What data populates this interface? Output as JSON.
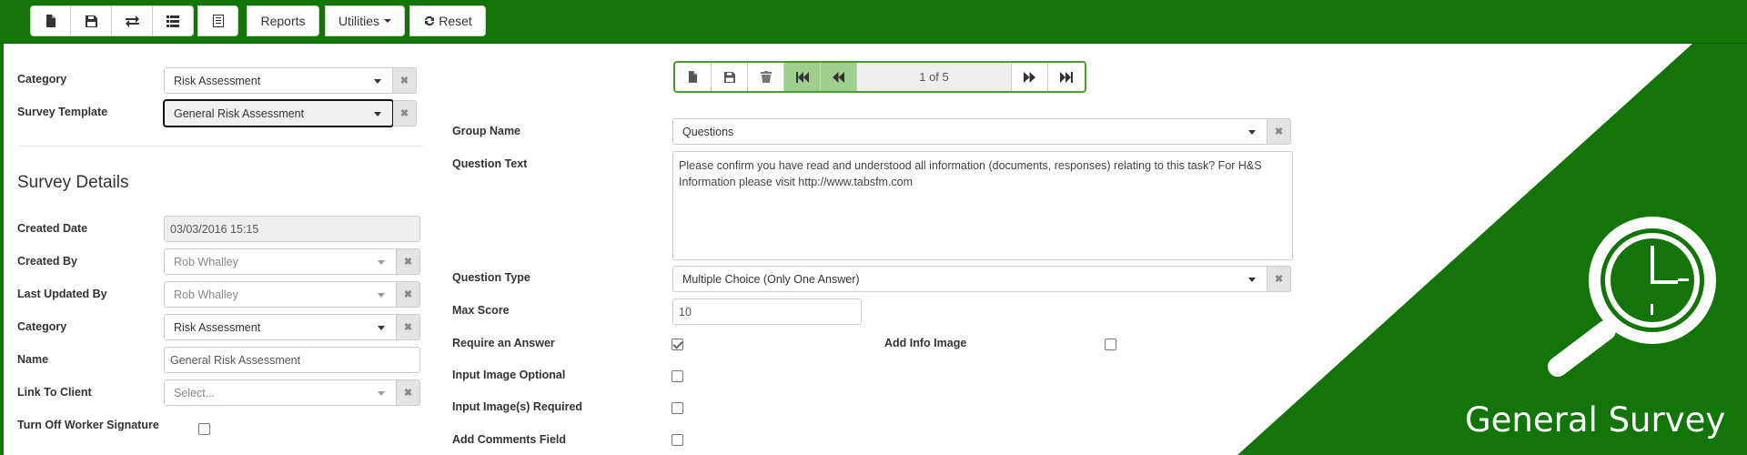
{
  "toolbar": {
    "icons": [
      "new-file-icon",
      "save-icon",
      "transfer-icon",
      "list-icon",
      "notes-icon"
    ],
    "reports_label": "Reports",
    "utilities_label": "Utilities",
    "reset_label": "Reset"
  },
  "left": {
    "category_label": "Category",
    "category_value": "Risk Assessment",
    "template_label": "Survey Template",
    "template_value": "General Risk Assessment",
    "section_title": "Survey Details",
    "created_date_label": "Created Date",
    "created_date_value": "03/03/2016 15:15",
    "created_by_label": "Created By",
    "created_by_value": "Rob Whalley",
    "updated_by_label": "Last Updated By",
    "updated_by_value": "Rob Whalley",
    "category2_label": "Category",
    "category2_value": "Risk Assessment",
    "name_label": "Name",
    "name_value": "General Risk Assessment",
    "client_label": "Link To Client",
    "client_placeholder": "Select...",
    "signature_label": "Turn Off Worker Signature",
    "signature_checked": false
  },
  "recnav": {
    "count": "1 of 5"
  },
  "question": {
    "group_label": "Group Name",
    "group_value": "Questions",
    "text_label": "Question Text",
    "text_value": "Please confirm you have read and understood all information (documents, responses) relating to this task? For H&S Information please visit http://www.tabsfm.com",
    "type_label": "Question Type",
    "type_value": "Multiple Choice (Only One Answer)",
    "max_score_label": "Max Score",
    "max_score_value": "10",
    "require_label": "Require an Answer",
    "require_checked": true,
    "info_image_label": "Add Info Image",
    "info_image_checked": false,
    "image_optional_label": "Input Image Optional",
    "image_required_label": "Input Image(s) Required",
    "comments_label": "Add Comments Field"
  },
  "brand": {
    "title": "General Survey",
    "icon": "clock-search-icon",
    "accent": "#137507"
  }
}
